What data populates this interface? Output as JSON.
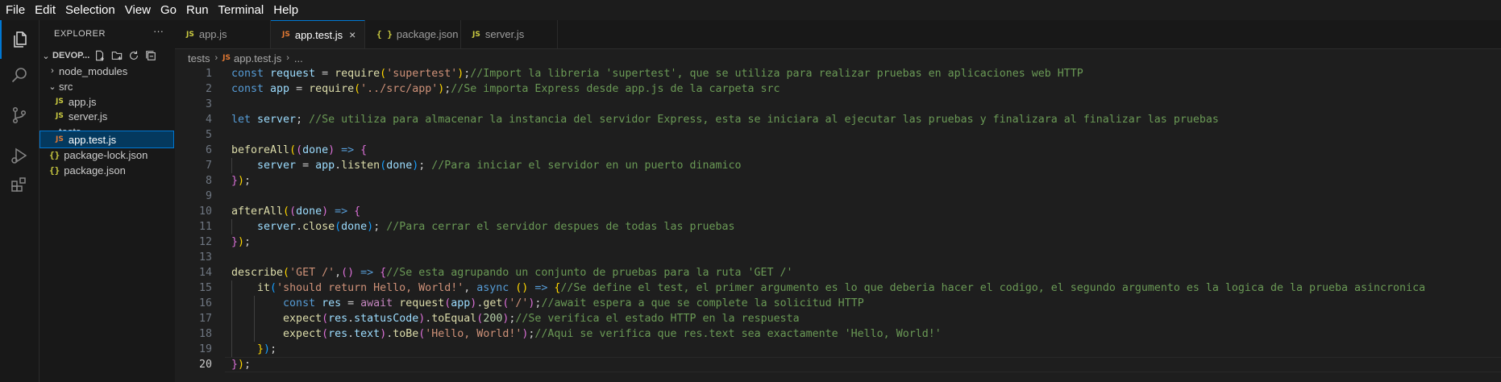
{
  "menu": [
    "File",
    "Edit",
    "Selection",
    "View",
    "Go",
    "Run",
    "Terminal",
    "Help"
  ],
  "activity_bar": [
    "explorer-icon",
    "search-icon",
    "source-control-icon",
    "run-debug-icon",
    "extensions-icon"
  ],
  "explorer": {
    "title": "EXPLORER",
    "more": "···",
    "folder": "DEVOP...",
    "items": [
      {
        "label": "node_modules",
        "type": "folder",
        "expanded": false
      },
      {
        "label": "src",
        "type": "folder",
        "expanded": true
      },
      {
        "label": "app.js",
        "type": "js"
      },
      {
        "label": "server.js",
        "type": "js"
      },
      {
        "label": "tests",
        "type": "folder",
        "expanded": true
      },
      {
        "label": "app.test.js",
        "type": "js",
        "selected": true
      },
      {
        "label": "package-lock.json",
        "type": "json"
      },
      {
        "label": "package.json",
        "type": "json"
      }
    ]
  },
  "tabs": [
    {
      "label": "app.js",
      "icon": "JS"
    },
    {
      "label": "app.test.js",
      "icon": "JS",
      "active": true,
      "close": "×"
    },
    {
      "label": "package.json",
      "icon": "{ }"
    },
    {
      "label": "server.js",
      "icon": "JS"
    }
  ],
  "breadcrumb": {
    "folder": "tests",
    "file": "app.test.js",
    "symbol": "..."
  },
  "editor": {
    "current_line": 20,
    "lines": [
      [
        [
          "kw",
          "const "
        ],
        [
          "var",
          "request"
        ],
        [
          "plain",
          " = "
        ],
        [
          "fn",
          "require"
        ],
        [
          "p1",
          "("
        ],
        [
          "str",
          "'supertest'"
        ],
        [
          "p1",
          ")"
        ],
        [
          "plain",
          ";"
        ],
        [
          "cmt",
          "//Import la libreria 'supertest', que se utiliza para realizar pruebas en aplicaciones web HTTP"
        ]
      ],
      [
        [
          "kw",
          "const "
        ],
        [
          "var",
          "app"
        ],
        [
          "plain",
          " = "
        ],
        [
          "fn",
          "require"
        ],
        [
          "p1",
          "("
        ],
        [
          "str",
          "'../src/app'"
        ],
        [
          "p1",
          ")"
        ],
        [
          "plain",
          ";"
        ],
        [
          "cmt",
          "//Se importa Express desde app.js de la carpeta src"
        ]
      ],
      [],
      [
        [
          "kw",
          "let "
        ],
        [
          "var",
          "server"
        ],
        [
          "plain",
          "; "
        ],
        [
          "cmt",
          "//Se utiliza para almacenar la instancia del servidor Express, esta se iniciara al ejecutar las pruebas y finalizara al finalizar las pruebas"
        ]
      ],
      [],
      [
        [
          "fn",
          "beforeAll"
        ],
        [
          "p1",
          "("
        ],
        [
          "p2",
          "("
        ],
        [
          "var",
          "done"
        ],
        [
          "p2",
          ")"
        ],
        [
          "kw",
          " => "
        ],
        [
          "p2",
          "{"
        ]
      ],
      [
        [
          "plain",
          "    "
        ],
        [
          "var",
          "server"
        ],
        [
          "plain",
          " = "
        ],
        [
          "var",
          "app"
        ],
        [
          "plain",
          "."
        ],
        [
          "fn",
          "listen"
        ],
        [
          "p3",
          "("
        ],
        [
          "var",
          "done"
        ],
        [
          "p3",
          ")"
        ],
        [
          "plain",
          "; "
        ],
        [
          "cmt",
          "//Para iniciar el servidor en un puerto dinamico"
        ]
      ],
      [
        [
          "p2",
          "}"
        ],
        [
          "p1",
          ")"
        ],
        [
          "plain",
          ";"
        ]
      ],
      [],
      [
        [
          "fn",
          "afterAll"
        ],
        [
          "p1",
          "("
        ],
        [
          "p2",
          "("
        ],
        [
          "var",
          "done"
        ],
        [
          "p2",
          ")"
        ],
        [
          "kw",
          " => "
        ],
        [
          "p2",
          "{"
        ]
      ],
      [
        [
          "plain",
          "    "
        ],
        [
          "var",
          "server"
        ],
        [
          "plain",
          "."
        ],
        [
          "fn",
          "close"
        ],
        [
          "p3",
          "("
        ],
        [
          "var",
          "done"
        ],
        [
          "p3",
          ")"
        ],
        [
          "plain",
          "; "
        ],
        [
          "cmt",
          "//Para cerrar el servidor despues de todas las pruebas"
        ]
      ],
      [
        [
          "p2",
          "}"
        ],
        [
          "p1",
          ")"
        ],
        [
          "plain",
          ";"
        ]
      ],
      [],
      [
        [
          "fn",
          "describe"
        ],
        [
          "p1",
          "("
        ],
        [
          "str",
          "'GET /'"
        ],
        [
          "plain",
          ","
        ],
        [
          "p2",
          "()"
        ],
        [
          "kw",
          " => "
        ],
        [
          "p2",
          "{"
        ],
        [
          "cmt",
          "//Se esta agrupando un conjunto de pruebas para la ruta 'GET /'"
        ]
      ],
      [
        [
          "plain",
          "    "
        ],
        [
          "fn",
          "it"
        ],
        [
          "p3",
          "("
        ],
        [
          "str",
          "'should return Hello, World!'"
        ],
        [
          "plain",
          ", "
        ],
        [
          "kw",
          "async "
        ],
        [
          "p1",
          "()"
        ],
        [
          "kw",
          " => "
        ],
        [
          "p1",
          "{"
        ],
        [
          "cmt",
          "//Se define el test, el primer argumento es lo que deberia hacer el codigo, el segundo argumento es la logica de la prueba asincronica"
        ]
      ],
      [
        [
          "plain",
          "        "
        ],
        [
          "kw",
          "const "
        ],
        [
          "var",
          "res"
        ],
        [
          "plain",
          " = "
        ],
        [
          "ctl",
          "await "
        ],
        [
          "fn",
          "request"
        ],
        [
          "p2",
          "("
        ],
        [
          "var",
          "app"
        ],
        [
          "p2",
          ")"
        ],
        [
          "plain",
          "."
        ],
        [
          "fn",
          "get"
        ],
        [
          "p2",
          "("
        ],
        [
          "str",
          "'/'"
        ],
        [
          "p2",
          ")"
        ],
        [
          "plain",
          ";"
        ],
        [
          "cmt",
          "//await espera a que se complete la solicitud HTTP"
        ]
      ],
      [
        [
          "plain",
          "        "
        ],
        [
          "fn",
          "expect"
        ],
        [
          "p2",
          "("
        ],
        [
          "var",
          "res"
        ],
        [
          "plain",
          "."
        ],
        [
          "var",
          "statusCode"
        ],
        [
          "p2",
          ")"
        ],
        [
          "plain",
          "."
        ],
        [
          "fn",
          "toEqual"
        ],
        [
          "p2",
          "("
        ],
        [
          "num",
          "200"
        ],
        [
          "p2",
          ")"
        ],
        [
          "plain",
          ";"
        ],
        [
          "cmt",
          "//Se verifica el estado HTTP en la respuesta"
        ]
      ],
      [
        [
          "plain",
          "        "
        ],
        [
          "fn",
          "expect"
        ],
        [
          "p2",
          "("
        ],
        [
          "var",
          "res"
        ],
        [
          "plain",
          "."
        ],
        [
          "var",
          "text"
        ],
        [
          "p2",
          ")"
        ],
        [
          "plain",
          "."
        ],
        [
          "fn",
          "toBe"
        ],
        [
          "p2",
          "("
        ],
        [
          "str",
          "'Hello, World!'"
        ],
        [
          "p2",
          ")"
        ],
        [
          "plain",
          ";"
        ],
        [
          "cmt",
          "//Aqui se verifica que res.text sea exactamente 'Hello, World!'"
        ]
      ],
      [
        [
          "plain",
          "    "
        ],
        [
          "p1",
          "}"
        ],
        [
          "p3",
          ")"
        ],
        [
          "plain",
          ";"
        ]
      ],
      [
        [
          "p2",
          "}"
        ],
        [
          "p1",
          ")"
        ],
        [
          "plain",
          ";"
        ]
      ]
    ]
  }
}
